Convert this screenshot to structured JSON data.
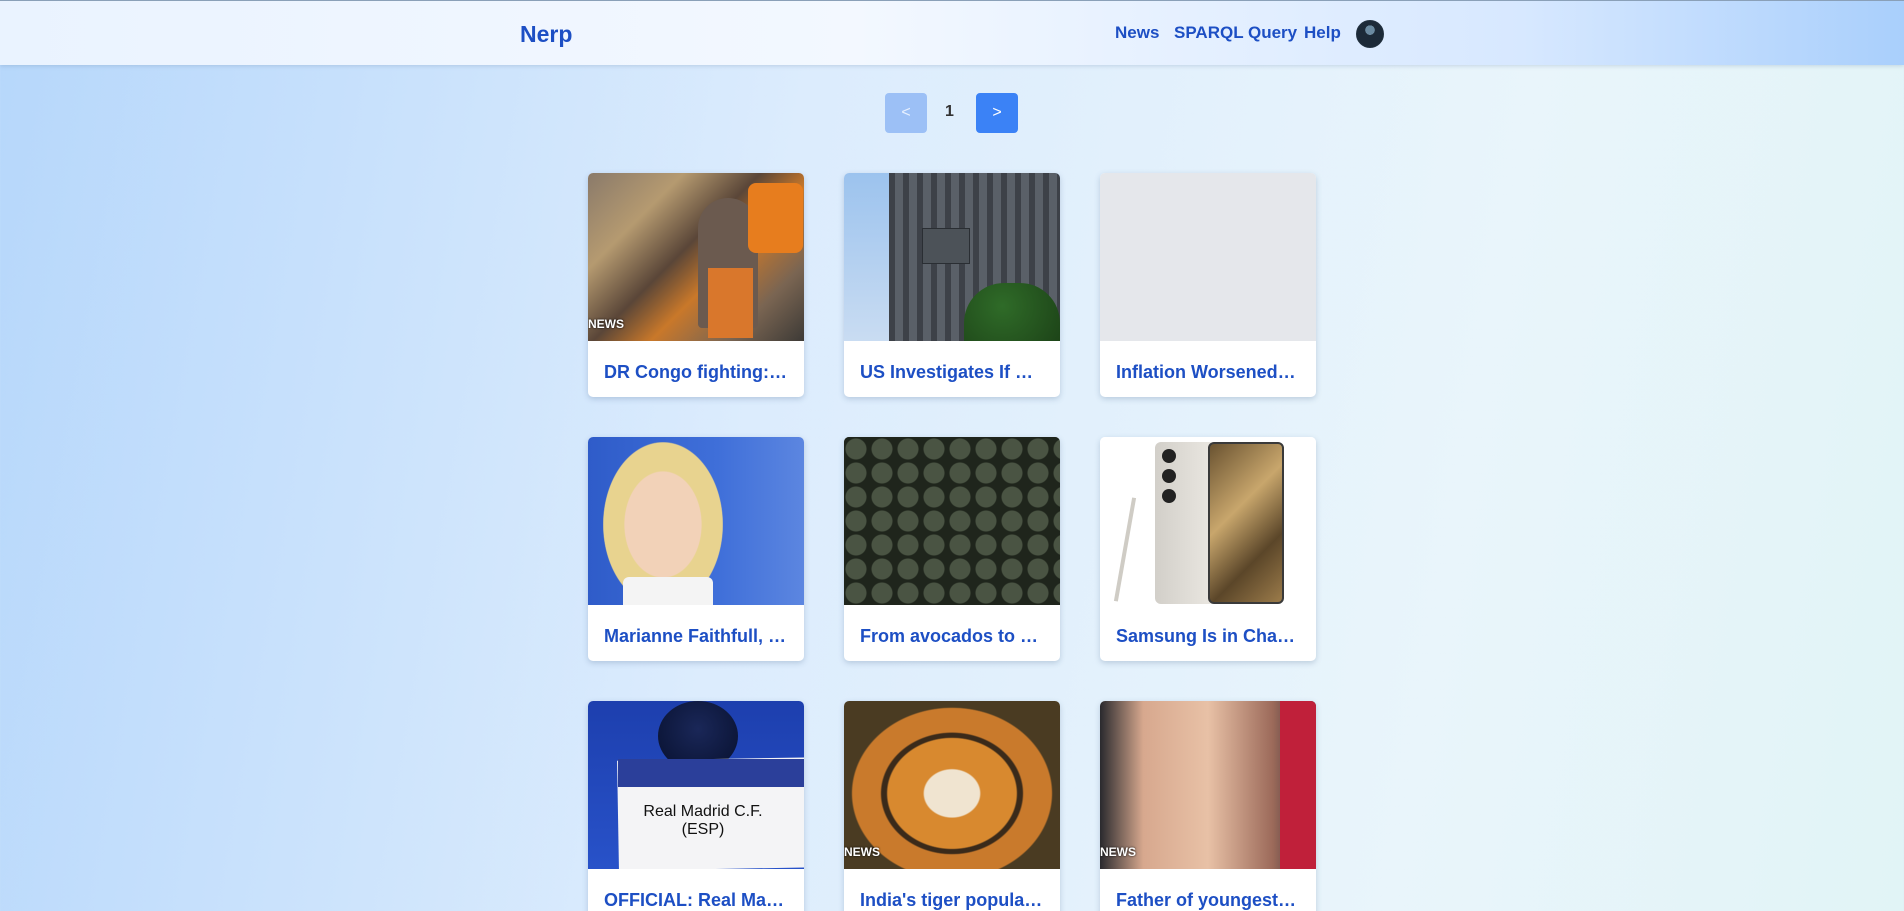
{
  "header": {
    "brand": "Nerp",
    "nav": [
      "News",
      "SPARQL Query",
      "Help"
    ]
  },
  "pagination": {
    "prev": "<",
    "current": "1",
    "next": ">"
  },
  "cards": [
    {
      "title": "DR Congo fighting:…",
      "badge": "NEWS"
    },
    {
      "title": "US Investigates If …",
      "badge": ""
    },
    {
      "title": "Inflation Worsened…",
      "badge": ""
    },
    {
      "title": "Marianne Faithfull, …",
      "badge": ""
    },
    {
      "title": "From avocados to …",
      "badge": ""
    },
    {
      "title": "Samsung Is in Cha…",
      "badge": ""
    },
    {
      "title": "OFFICIAL: Real Ma…",
      "badge": "",
      "image_text": [
        "Real Madrid C.F.",
        "(ESP)"
      ]
    },
    {
      "title": "India's tiger popula…",
      "badge": "NEWS"
    },
    {
      "title": "Father of youngest…",
      "badge": "NEWS"
    }
  ],
  "colors": {
    "link": "#1d4fc4",
    "pager_active": "#3b82f6",
    "pager_disabled": "#9cc0f6"
  }
}
